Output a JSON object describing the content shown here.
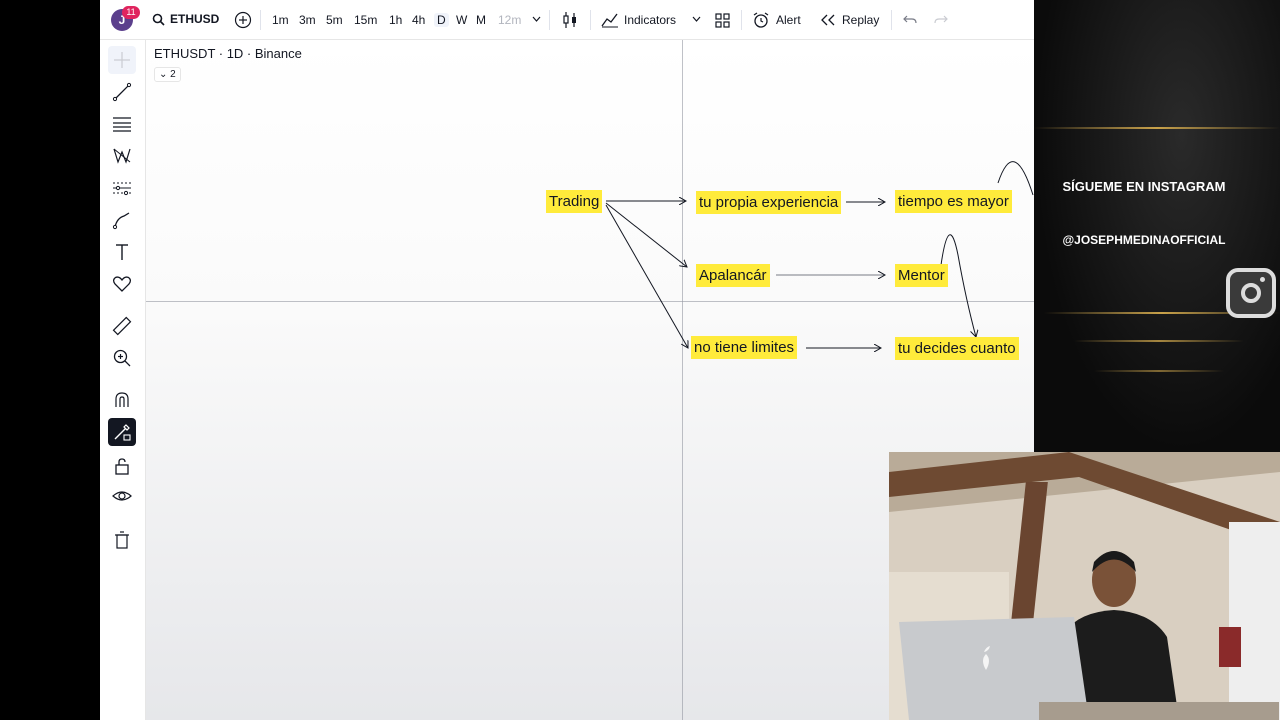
{
  "topbar": {
    "avatar_letter": "J",
    "notification_count": "11",
    "symbol": "ETHUSD",
    "intervals": [
      "1m",
      "3m",
      "5m",
      "15m",
      "1h",
      "4h",
      "D",
      "W",
      "M"
    ],
    "active_interval": "D",
    "custom_interval": "12m",
    "indicators_label": "Indicators",
    "alert_label": "Alert",
    "replay_label": "Replay"
  },
  "chart": {
    "title": "ETHUSDT · 1D · Binance",
    "collapse_label": "2",
    "notes": {
      "trading": "Trading",
      "experiencia": "tu propia experiencia",
      "tiempo": "tiempo es mayor",
      "apalancar": "Apalancár",
      "mentor": "Mentor",
      "limites": "no tiene limites",
      "decides": "tu decides cuanto"
    }
  },
  "overlay": {
    "follow_text": "SÍGUEME EN INSTAGRAM",
    "handle": "@JOSEPHMEDINAOFFICIAL"
  },
  "colors": {
    "note_bg": "#ffeb3b",
    "accent_dark": "#131722",
    "gold": "#c9a24a",
    "badge": "#e0245e"
  }
}
